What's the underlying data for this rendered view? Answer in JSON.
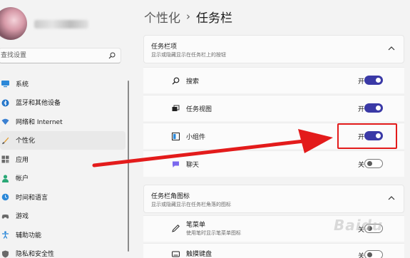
{
  "sidebar": {
    "search_placeholder": "查找设置",
    "items": [
      {
        "label": "系统",
        "icon": "monitor-icon",
        "active": false
      },
      {
        "label": "蓝牙和其他设备",
        "icon": "bluetooth-icon",
        "active": false
      },
      {
        "label": "网络和 Internet",
        "icon": "wifi-icon",
        "active": false
      },
      {
        "label": "个性化",
        "icon": "brush-icon",
        "active": true
      },
      {
        "label": "应用",
        "icon": "apps-icon",
        "active": false
      },
      {
        "label": "帐户",
        "icon": "person-icon",
        "active": false
      },
      {
        "label": "时间和语言",
        "icon": "globe-clock-icon",
        "active": false
      },
      {
        "label": "游戏",
        "icon": "gamepad-icon",
        "active": false
      },
      {
        "label": "辅助功能",
        "icon": "accessibility-icon",
        "active": false
      },
      {
        "label": "隐私和安全性",
        "icon": "shield-icon",
        "active": false
      }
    ]
  },
  "breadcrumb": {
    "parent": "个性化",
    "separator": "›",
    "current": "任务栏"
  },
  "taskbar_items": {
    "title": "任务栏项",
    "subtitle": "显示或隐藏显示在任务栏上的按钮",
    "rows": [
      {
        "label": "搜索",
        "icon": "search-icon",
        "state": "开",
        "on": true
      },
      {
        "label": "任务视图",
        "icon": "task-view-icon",
        "state": "开",
        "on": true
      },
      {
        "label": "小组件",
        "icon": "widgets-icon",
        "state": "开",
        "on": true
      },
      {
        "label": "聊天",
        "icon": "chat-icon",
        "state": "关",
        "on": false
      }
    ]
  },
  "corner_icons": {
    "title": "任务栏角图标",
    "subtitle": "显示或隐藏显示在任务栏角落的图标",
    "rows": [
      {
        "label": "笔菜单",
        "sub": "使用笔时显示笔菜单图标",
        "icon": "pen-icon",
        "state": "关",
        "on": false
      },
      {
        "label": "触摸键盘",
        "icon": "keyboard-icon",
        "state": "关",
        "on": false
      }
    ]
  },
  "watermark": "Baidu",
  "colors": {
    "accent": "#3a39a6",
    "annotation": "#e31b1b"
  }
}
